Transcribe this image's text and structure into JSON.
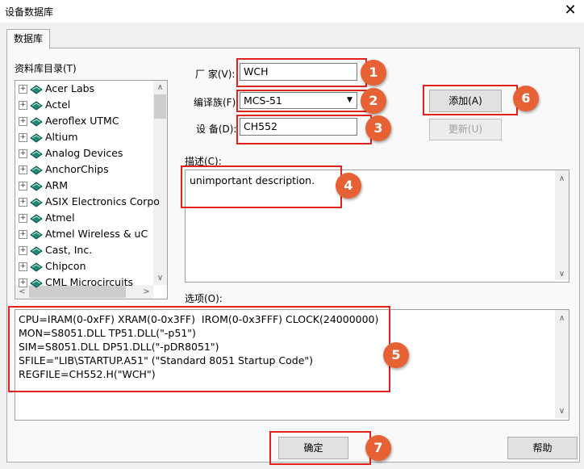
{
  "window": {
    "title": "设备数据库",
    "close_glyph": "✕"
  },
  "tab": {
    "label": "数据库"
  },
  "tree": {
    "label": "资料库目录(T)",
    "items": [
      "Acer Labs",
      "Actel",
      "Aeroflex UTMC",
      "Altium",
      "Analog Devices",
      "AnchorChips",
      "ARM",
      "ASIX Electronics Corpo",
      "Atmel",
      "Atmel Wireless & uC",
      "Cast, Inc.",
      "Chipcon",
      "CML Microcircuits"
    ]
  },
  "fields": {
    "vendor_label": "厂  家(V):",
    "vendor_value": "WCH",
    "family_label": "编译族(F):",
    "family_value": "MCS-51",
    "device_label": "设  备(D):",
    "device_value": "CH552"
  },
  "buttons": {
    "add": "添加(A)",
    "update": "更新(U)",
    "ok": "确定",
    "help": "帮助"
  },
  "description": {
    "label": "描述(C):",
    "value": "unimportant description."
  },
  "options": {
    "label": "选项(O):",
    "lines": [
      "CPU=IRAM(0-0xFF) XRAM(0-0x3FF)  IROM(0-0x3FFF) CLOCK(24000000)",
      "MON=S8051.DLL TP51.DLL(\"-p51\")",
      "SIM=S8051.DLL DP51.DLL(\"-pDR8051\")",
      "SFILE=\"LIB\\STARTUP.A51\" (\"Standard 8051 Startup Code\")",
      "REGFILE=CH552.H(\"WCH\")"
    ]
  },
  "annotations": [
    "1",
    "2",
    "3",
    "4",
    "5",
    "6",
    "7"
  ],
  "colors": {
    "badge": "#e66234",
    "highlight_box": "#e0231c"
  },
  "icons": {
    "tree_item": "book-icon",
    "expand": "plus-icon"
  }
}
